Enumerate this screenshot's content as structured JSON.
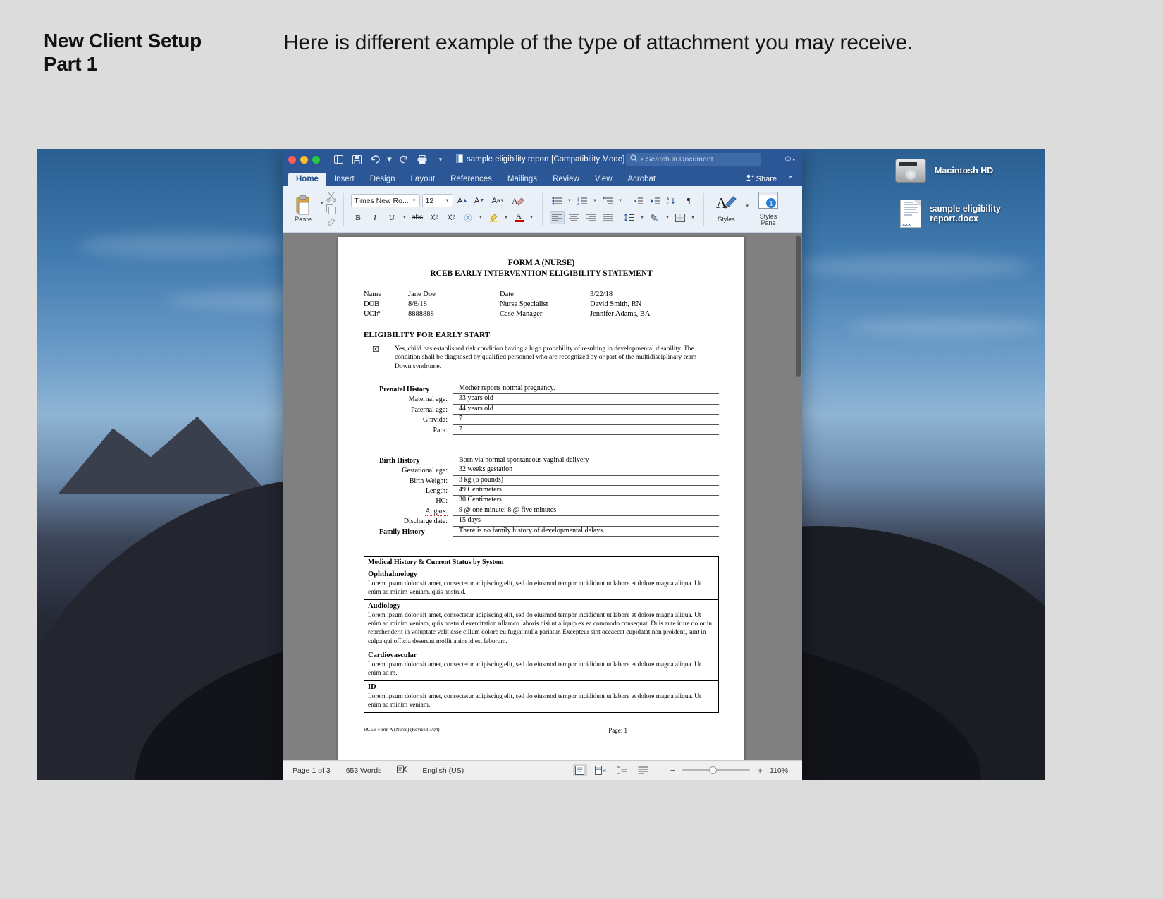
{
  "slide": {
    "title": "New Client Setup\nPart 1",
    "title_line1": "New Client Setup",
    "title_line2": "Part 1",
    "subtitle": "Here is different example of the type of attachment you may receive."
  },
  "window": {
    "doc_title": "sample eligibility report [Compatibility Mode]",
    "search_placeholder": "Search in Document",
    "share_label": "Share",
    "tabs": [
      {
        "label": "Home",
        "active": true
      },
      {
        "label": "Insert",
        "active": false
      },
      {
        "label": "Design",
        "active": false
      },
      {
        "label": "Layout",
        "active": false
      },
      {
        "label": "References",
        "active": false
      },
      {
        "label": "Mailings",
        "active": false
      },
      {
        "label": "Review",
        "active": false
      },
      {
        "label": "View",
        "active": false
      },
      {
        "label": "Acrobat",
        "active": false
      }
    ],
    "titlebar_icons": [
      "sidebar-icon",
      "save-icon",
      "undo-icon",
      "redo-icon",
      "print-icon",
      "overflow-icon"
    ]
  },
  "ribbon": {
    "paste_label": "Paste",
    "font_name": "Times New Ro...",
    "font_size": "12",
    "styles_label": "Styles",
    "styles_pane_label": "Styles\nPane",
    "styles_pane_l1": "Styles",
    "styles_pane_l2": "Pane",
    "styles_pane_badge": "1"
  },
  "statusbar": {
    "page_status": "Page 1 of 3",
    "word_count": "653 Words",
    "language": "English (US)",
    "zoom": "110%",
    "zoom_out": "−",
    "zoom_in": "+"
  },
  "desktop": {
    "icons": [
      {
        "name": "Macintosh HD",
        "type": "hard-drive"
      },
      {
        "name": "sample eligibility report.docx",
        "type": "document"
      }
    ]
  },
  "document": {
    "title_line1": "FORM A (NURSE)",
    "title_line2": "RCEB EARLY INTERVENTION ELIGIBILITY STATEMENT",
    "identity": [
      {
        "l1": "Name",
        "v1": "Jane Doe",
        "l2": "Date",
        "v2": "3/22/18"
      },
      {
        "l1": "DOB",
        "v1": "8/8/18",
        "l2": "Nurse Specialist",
        "v2": "David Smith, RN"
      },
      {
        "l1": "UCI#",
        "v1": "8888888",
        "l2": "Case Manager",
        "v2": "Jennifer Adams, BA"
      }
    ],
    "eligibility_heading": "ELIGIBILITY FOR EARLY START",
    "eligibility_checkbox": "☒",
    "eligibility_text": "Yes, child has established risk condition having a high probability of resulting in developmental disability. The condition shall be diagnosed by qualified personnel who are recognized by or part of the multidisciplinary team – Down syndrome.",
    "prenatal": {
      "heading": "Prenatal History",
      "heading_value": "Mother reports normal pregnancy.",
      "rows": [
        {
          "label": "Maternal age:",
          "value": "33 years old"
        },
        {
          "label": "Paternal age:",
          "value": "44 years old"
        },
        {
          "label": "Gravida:",
          "value": "7"
        },
        {
          "label": "Para:",
          "value": "7"
        }
      ]
    },
    "birth": {
      "heading": "Birth History",
      "heading_value": "Born via normal spontaneous vaginal delivery",
      "rows": [
        {
          "label": "Gestational age:",
          "value": "32 weeks gestation"
        },
        {
          "label": "Birth Weight:",
          "value": "3 kg (6 pounds)"
        },
        {
          "label": "Length:",
          "value": "49 Centimeters"
        },
        {
          "label": "HC:",
          "value": "30 Centimeters"
        },
        {
          "label": "Apgars:",
          "value": "9 @ one minute; 8 @ five minutes"
        },
        {
          "label": "Discharge date:",
          "value": "15 days"
        }
      ]
    },
    "family": {
      "heading": "Family History",
      "heading_value": "There is no family history of developmental delays."
    },
    "medical_table": {
      "header": "Medical History & Current Status by System",
      "sections": [
        {
          "title": "Ophthalmology",
          "body": "Lorem ipsum dolor sit amet, consectetur adipiscing elit, sed do eiusmod tempor incididunt ut labore et dolore magna aliqua. Ut enim ad minim veniam, quis nostrud."
        },
        {
          "title": "Audiology",
          "body": "Lorem ipsum dolor sit amet, consectetur adipiscing elit, sed do eiusmod tempor incididunt ut labore et dolore magna aliqua. Ut enim ad minim veniam, quis nostrud exercitation ullamco laboris nisi ut aliquip ex ea commodo consequat. Duis aute irure dolor in reprehenderit in voluptate velit esse cillum dolore eu fugiat nulla pariatur. Excepteur sint occaecat cupidatat non proident, sunt in culpa qui officia deserunt mollit anim id est laborum."
        },
        {
          "title": "Cardiovascular",
          "body": "Lorem ipsum dolor sit amet, consectetur adipiscing elit, sed do eiusmod tempor incididunt ut labore et dolore magna aliqua. Ut enim ad m."
        },
        {
          "title": "ID",
          "body": "Lorem ipsum dolor sit amet, consectetur adipiscing elit, sed do eiusmod tempor incididunt ut labore et dolore magna aliqua. Ut enim ad minim veniam."
        }
      ]
    },
    "footer_left": "RCEB Form A (Nurse) (Revised 7/04)",
    "footer_page": "Page:  1"
  },
  "colors": {
    "word_blue": "#2b5797",
    "ribbon_bg": "#e9f0f8",
    "slide_bg": "#dcdcdc"
  }
}
